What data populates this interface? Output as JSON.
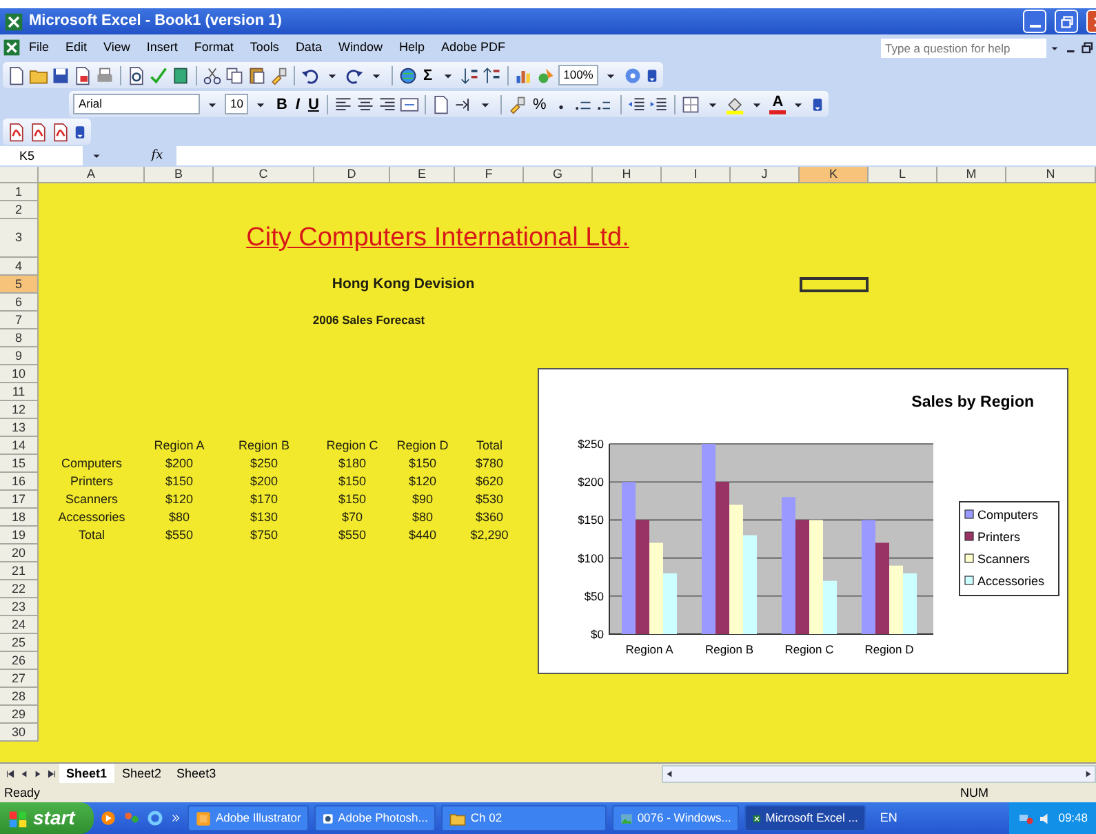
{
  "window": {
    "title": "Microsoft Excel - Book1 (version 1)"
  },
  "menu": [
    "File",
    "Edit",
    "View",
    "Insert",
    "Format",
    "Tools",
    "Data",
    "Window",
    "Help",
    "Adobe PDF"
  ],
  "help_box": {
    "placeholder": "Type a question for help"
  },
  "standard_toolbar": {
    "autosum": "Σ",
    "zoom": "100%"
  },
  "formatting_toolbar": {
    "font": "Arial",
    "font_size": "10",
    "bold": "B",
    "italic": "I",
    "underline": "U",
    "percent": "%",
    "font_color": "A"
  },
  "formula_bar": {
    "name_box": "K5",
    "function_label": "fx"
  },
  "columns": [
    {
      "label": "A",
      "selected": false
    },
    {
      "label": "B",
      "selected": false
    },
    {
      "label": "C",
      "selected": false
    },
    {
      "label": "D",
      "selected": false
    },
    {
      "label": "E",
      "selected": false
    },
    {
      "label": "F",
      "selected": false
    },
    {
      "label": "G",
      "selected": false
    },
    {
      "label": "H",
      "selected": false
    },
    {
      "label": "I",
      "selected": false
    },
    {
      "label": "J",
      "selected": false
    },
    {
      "label": "K",
      "selected": true
    },
    {
      "label": "L",
      "selected": false
    },
    {
      "label": "M",
      "selected": false
    },
    {
      "label": "N",
      "selected": false
    }
  ],
  "rows": [
    {
      "label": "1",
      "selected": false
    },
    {
      "label": "2",
      "selected": false
    },
    {
      "label": "3",
      "selected": false
    },
    {
      "label": "4",
      "selected": false
    },
    {
      "label": "5",
      "selected": true
    },
    {
      "label": "6",
      "selected": false
    },
    {
      "label": "7",
      "selected": false
    },
    {
      "label": "8",
      "selected": false
    },
    {
      "label": "9",
      "selected": false
    },
    {
      "label": "10",
      "selected": false
    },
    {
      "label": "11",
      "selected": false
    },
    {
      "label": "12",
      "selected": false
    },
    {
      "label": "13",
      "selected": false
    },
    {
      "label": "14",
      "selected": false
    },
    {
      "label": "15",
      "selected": false
    },
    {
      "label": "16",
      "selected": false
    },
    {
      "label": "17",
      "selected": false
    },
    {
      "label": "18",
      "selected": false
    },
    {
      "label": "19",
      "selected": false
    },
    {
      "label": "20",
      "selected": false
    },
    {
      "label": "21",
      "selected": false
    },
    {
      "label": "22",
      "selected": false
    },
    {
      "label": "23",
      "selected": false
    },
    {
      "label": "24",
      "selected": false
    },
    {
      "label": "25",
      "selected": false
    },
    {
      "label": "26",
      "selected": false
    },
    {
      "label": "27",
      "selected": false
    },
    {
      "label": "28",
      "selected": false
    },
    {
      "label": "29",
      "selected": false
    },
    {
      "label": "30",
      "selected": false
    }
  ],
  "sheet": {
    "title": "City Computers International Ltd.",
    "division": "Hong Kong Devision",
    "caption": "2006 Sales Forecast",
    "table": {
      "header": [
        "Region A",
        "Region B",
        "Region C",
        "Region D",
        "Total"
      ],
      "rows": [
        {
          "label": "Computers",
          "values": [
            "$200",
            "$250",
            "$180",
            "$150",
            "$780"
          ]
        },
        {
          "label": "Printers",
          "values": [
            "$150",
            "$200",
            "$150",
            "$120",
            "$620"
          ]
        },
        {
          "label": "Scanners",
          "values": [
            "$120",
            "$170",
            "$150",
            "$90",
            "$530"
          ]
        },
        {
          "label": "Accessories",
          "values": [
            "$80",
            "$130",
            "$70",
            "$80",
            "$360"
          ]
        },
        {
          "label": "Total",
          "values": [
            "$550",
            "$750",
            "$550",
            "$440",
            "$2,290"
          ]
        }
      ]
    }
  },
  "chart": {
    "chart_data": {
      "type": "bar",
      "title": "Sales by Region",
      "categories": [
        "Region A",
        "Region B",
        "Region C",
        "Region D"
      ],
      "series": [
        {
          "name": "Computers",
          "color": "#9999ff",
          "values": [
            200,
            250,
            180,
            150
          ]
        },
        {
          "name": "Printers",
          "color": "#993366",
          "values": [
            150,
            200,
            150,
            120
          ]
        },
        {
          "name": "Scanners",
          "color": "#ffffcc",
          "values": [
            120,
            170,
            150,
            90
          ]
        },
        {
          "name": "Accessories",
          "color": "#ccffff",
          "values": [
            80,
            130,
            70,
            80
          ]
        }
      ],
      "ylim": [
        0,
        250
      ],
      "grid": true,
      "legend": "right",
      "yticks": [
        {
          "value": 0,
          "label": "$0"
        },
        {
          "value": 50,
          "label": "$50"
        },
        {
          "value": 100,
          "label": "$100"
        },
        {
          "value": 150,
          "label": "$150"
        },
        {
          "value": 200,
          "label": "$200"
        },
        {
          "value": 250,
          "label": "$250"
        }
      ]
    }
  },
  "sheet_tabs": [
    {
      "label": "Sheet1",
      "selected": true
    },
    {
      "label": "Sheet2",
      "selected": false
    },
    {
      "label": "Sheet3",
      "selected": false
    }
  ],
  "status_bar": {
    "status": "Ready",
    "num": "NUM"
  },
  "taskbar": {
    "start": "start",
    "tasks": [
      {
        "label": "Adobe Illustrator",
        "selected": false
      },
      {
        "label": "Adobe Photosh...",
        "selected": false
      },
      {
        "label": "Ch 02",
        "selected": false
      },
      {
        "label": "0076 - Windows...",
        "selected": false
      },
      {
        "label": "Microsoft Excel ...",
        "selected": true
      }
    ],
    "language": "EN",
    "clock": "09:48"
  }
}
